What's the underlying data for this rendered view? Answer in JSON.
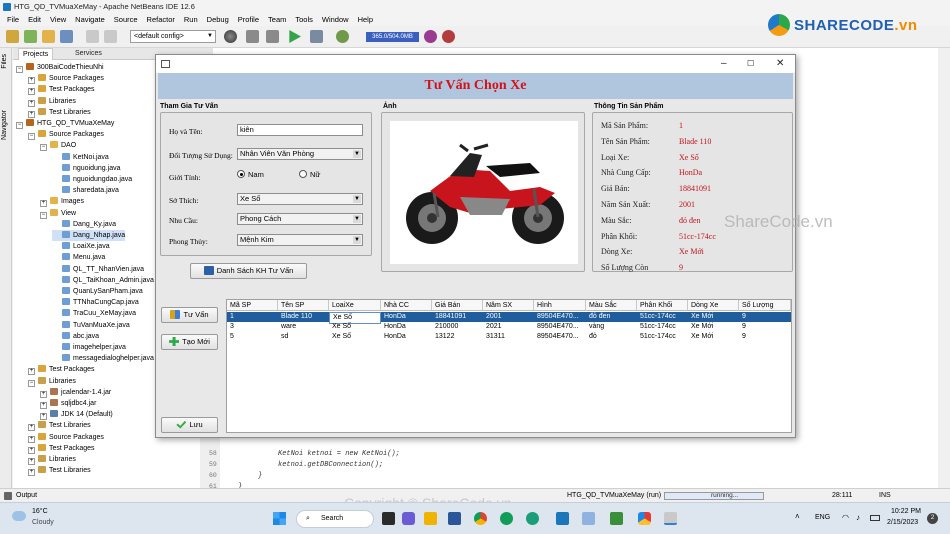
{
  "ide": {
    "title": "HTG_QD_TVMuaXeMay - Apache NetBeans IDE 12.6",
    "menu": [
      "File",
      "Edit",
      "View",
      "Navigate",
      "Source",
      "Refactor",
      "Run",
      "Debug",
      "Profile",
      "Team",
      "Tools",
      "Window",
      "Help"
    ],
    "config": "<default config>",
    "memory": "365.0/504.0MB",
    "side_tabs": [
      "Files",
      "Navigator"
    ],
    "panel_tabs": [
      "Projects",
      "Services"
    ],
    "tree": [
      {
        "label": "300BaiCodeThieuNhi",
        "depth": 0,
        "exp": "−",
        "icon": "project-icon"
      },
      {
        "label": "Source Packages",
        "depth": 1,
        "exp": "+",
        "icon": "package-icon"
      },
      {
        "label": "Test Packages",
        "depth": 1,
        "exp": "+",
        "icon": "package-icon"
      },
      {
        "label": "Libraries",
        "depth": 1,
        "exp": "+",
        "icon": "library-icon"
      },
      {
        "label": "Test Libraries",
        "depth": 1,
        "exp": "+",
        "icon": "library-icon"
      },
      {
        "label": "HTG_QD_TVMuaXeMay",
        "depth": 0,
        "exp": "−",
        "icon": "project-icon"
      },
      {
        "label": "Source Packages",
        "depth": 1,
        "exp": "−",
        "icon": "package-icon"
      },
      {
        "label": "DAO",
        "depth": 2,
        "exp": "−",
        "icon": "folder-icon"
      },
      {
        "label": "KetNoi.java",
        "depth": 3,
        "exp": "",
        "icon": "java-file-icon"
      },
      {
        "label": "nguoidung.java",
        "depth": 3,
        "exp": "",
        "icon": "java-file-icon"
      },
      {
        "label": "nguoidungdao.java",
        "depth": 3,
        "exp": "",
        "icon": "java-file-icon"
      },
      {
        "label": "sharedata.java",
        "depth": 3,
        "exp": "",
        "icon": "java-file-icon"
      },
      {
        "label": "Images",
        "depth": 2,
        "exp": "+",
        "icon": "folder-icon"
      },
      {
        "label": "View",
        "depth": 2,
        "exp": "−",
        "icon": "folder-icon"
      },
      {
        "label": "Dang_Ky.java",
        "depth": 3,
        "exp": "",
        "icon": "java-file-icon"
      },
      {
        "label": "Dang_Nhap.java",
        "depth": 3,
        "exp": "",
        "icon": "java-file-icon",
        "selected": true
      },
      {
        "label": "LoaiXe.java",
        "depth": 3,
        "exp": "",
        "icon": "java-file-icon"
      },
      {
        "label": "Menu.java",
        "depth": 3,
        "exp": "",
        "icon": "java-file-icon"
      },
      {
        "label": "QL_TT_NhanVien.java",
        "depth": 3,
        "exp": "",
        "icon": "java-file-icon"
      },
      {
        "label": "QL_TaiKhoan_Admin.java",
        "depth": 3,
        "exp": "",
        "icon": "java-file-icon"
      },
      {
        "label": "QuanLySanPham.java",
        "depth": 3,
        "exp": "",
        "icon": "java-file-icon"
      },
      {
        "label": "TTNhaCungCap.java",
        "depth": 3,
        "exp": "",
        "icon": "java-file-icon"
      },
      {
        "label": "TraCuu_XeMay.java",
        "depth": 3,
        "exp": "",
        "icon": "java-file-icon"
      },
      {
        "label": "TuVanMuaXe.java",
        "depth": 3,
        "exp": "",
        "icon": "java-file-icon"
      },
      {
        "label": "abc.java",
        "depth": 3,
        "exp": "",
        "icon": "java-file-icon"
      },
      {
        "label": "imagehelper.java",
        "depth": 3,
        "exp": "",
        "icon": "java-file-icon"
      },
      {
        "label": "messagedialoghelper.java",
        "depth": 3,
        "exp": "",
        "icon": "java-file-icon"
      },
      {
        "label": "Test Packages",
        "depth": 1,
        "exp": "+",
        "icon": "package-icon"
      },
      {
        "label": "Libraries",
        "depth": 1,
        "exp": "−",
        "icon": "library-icon"
      },
      {
        "label": "jcalendar-1.4.jar",
        "depth": 2,
        "exp": "+",
        "icon": "jar-icon"
      },
      {
        "label": "sqljdbc4.jar",
        "depth": 2,
        "exp": "+",
        "icon": "jar-icon"
      },
      {
        "label": "JDK 14 (Default)",
        "depth": 2,
        "exp": "+",
        "icon": "jdk-icon"
      },
      {
        "label": "Test Libraries",
        "depth": 1,
        "exp": "+",
        "icon": "library-icon"
      },
      {
        "label": "Source Packages",
        "depth": 1,
        "exp": "+",
        "icon": "package-icon"
      },
      {
        "label": "Test Packages",
        "depth": 1,
        "exp": "+",
        "icon": "package-icon"
      },
      {
        "label": "Libraries",
        "depth": 1,
        "exp": "+",
        "icon": "library-icon"
      },
      {
        "label": "Test Libraries",
        "depth": 1,
        "exp": "+",
        "icon": "library-icon"
      }
    ],
    "code_lines": [
      {
        "num": "58",
        "text": "KetNoi ketnoi = new KetNoi();"
      },
      {
        "num": "59",
        "text": "ketnoi.getDBConnection();"
      },
      {
        "num": "60",
        "text": "}"
      },
      {
        "num": "61",
        "text": "}"
      }
    ],
    "status": {
      "output": "Output",
      "project": "HTG_QD_TVMuaXeMay (run)",
      "progress": "running...",
      "position": "28:111",
      "mode": "INS"
    }
  },
  "logo": {
    "brand": "SHARECODE",
    "suffix": ".vn"
  },
  "watermark": "ShareCode.vn",
  "copyright": "Copyright © ShareCode.vn",
  "dialog": {
    "title": "Tư Vấn Chọn Xe",
    "left_section": "Tham Gia Tư Vấn",
    "fields": {
      "name_label": "Họ và Tên:",
      "name_value": "kiên",
      "target_label": "Đối Tượng Sử Dụng:",
      "target_value": "Nhân Viên Văn Phòng",
      "gender_label": "Giới Tính:",
      "gender_male": "Nam",
      "gender_female": "Nữ",
      "hobby_label": "Sở Thích:",
      "hobby_value": "Xe Số",
      "need_label": "Nhu Cầu:",
      "need_value": "Phong Cách",
      "fengshui_label": "Phong Thủy:",
      "fengshui_value": "Mệnh Kim"
    },
    "btn_list": "Danh Sách KH Tư Vấn",
    "image_section": "Ảnh",
    "info_section": "Thông Tin Sản Phẩm",
    "info": [
      {
        "label": "Mã Sản Phẩm:",
        "value": "1"
      },
      {
        "label": "Tên Sản Phẩm:",
        "value": "Blade 110"
      },
      {
        "label": "Loại Xe:",
        "value": "Xe Số"
      },
      {
        "label": "Nhà Cung Cấp:",
        "value": "HonDa"
      },
      {
        "label": "Giá Bán:",
        "value": "18841091"
      },
      {
        "label": "Năm Sản Xuất:",
        "value": "2001"
      },
      {
        "label": "Màu Sắc:",
        "value": "đỏ đen"
      },
      {
        "label": "Phân Khối:",
        "value": "51cc-174cc"
      },
      {
        "label": "Dòng Xe:",
        "value": "Xe Mới"
      },
      {
        "label": "Số Lượng Còn",
        "value": "9"
      }
    ],
    "btn_consult": "Tư Vấn",
    "btn_new": "Tạo Mới",
    "btn_save": "Lưu",
    "table": {
      "headers": [
        "Mã SP",
        "Tên SP",
        "LoaiXe",
        "Nhà CC",
        "Giá Bán",
        "Năm SX",
        "Hình",
        "Màu Sắc",
        "Phân Khối",
        "Dòng Xe",
        "Số Lượng"
      ],
      "rows": [
        [
          "1",
          "Blade 110",
          "Xe Số",
          "HonDa",
          "18841091",
          "2001",
          "89504E470...",
          "đỏ đen",
          "51cc-174cc",
          "Xe Mới",
          "9"
        ],
        [
          "3",
          "ware",
          "Xe Số",
          "HonDa",
          "210000",
          "2021",
          "89504E470...",
          "vàng",
          "51cc-174cc",
          "Xe Mới",
          "9"
        ],
        [
          "5",
          "sd",
          "Xe Số",
          "HonDa",
          "13122",
          "31311",
          "89504E470...",
          "đỏ",
          "51cc-174cc",
          "Xe Mới",
          "9"
        ]
      ]
    }
  },
  "taskbar": {
    "temp": "16°C",
    "weather": "Cloudy",
    "search": "Search",
    "lang": "ENG",
    "time": "10:22 PM",
    "date": "2/15/2023",
    "notif": "2"
  },
  "colors": {
    "accent_title": "#d3121a",
    "header_band": "#b0c6df",
    "value_red": "#c0141c",
    "selection": "#1f5d9c"
  }
}
